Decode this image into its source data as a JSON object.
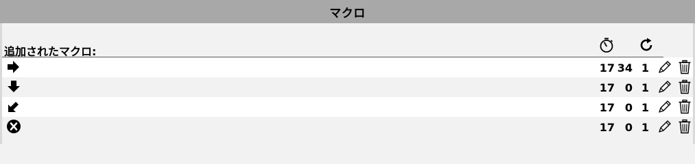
{
  "window": {
    "title": "マクロ"
  },
  "list": {
    "heading": "追加されたマクロ:",
    "header_icons": [
      "timer-icon",
      "repeat-icon"
    ]
  },
  "macros": [
    {
      "icon": "arrow-right-icon",
      "a": "17",
      "b": "34",
      "c": "1"
    },
    {
      "icon": "arrow-down-icon",
      "a": "17",
      "b": "0",
      "c": "1"
    },
    {
      "icon": "arrow-down-left-icon",
      "a": "17",
      "b": "0",
      "c": "1"
    },
    {
      "icon": "x-circle-icon",
      "a": "17",
      "b": "0",
      "c": "1"
    }
  ],
  "actions": [
    "edit-icon",
    "delete-icon"
  ]
}
